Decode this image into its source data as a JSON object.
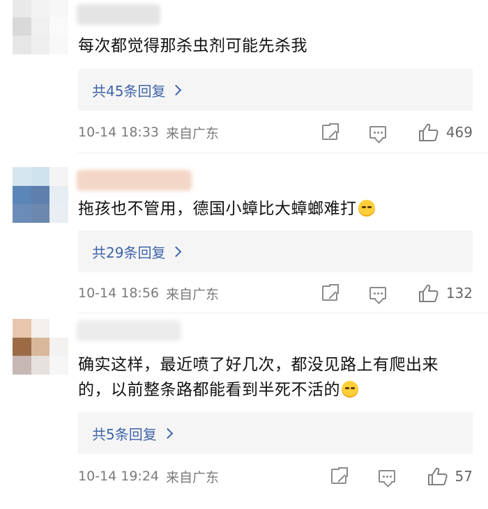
{
  "comments": [
    {
      "text": "每次都觉得那杀虫剂可能先杀我",
      "reply_label": "共45条回复",
      "time": "10-14 18:33",
      "location": "来自广东",
      "likes": "469",
      "avatar_colors": [
        "#e9e9e9",
        "#f3f3f3",
        "#f7f7f7",
        "#d9d9d9",
        "#f0f0f0",
        "#fafafa",
        "#e6e6e6",
        "#efefef",
        "#f8f8f8"
      ],
      "username_color": "#e4e4e4"
    },
    {
      "text": "拖孩也不管用，德国小蟑比大蟑螂难打",
      "emoji": "sleepy-face-emoji",
      "reply_label": "共29条回复",
      "time": "10-14 18:56",
      "location": "来自广东",
      "likes": "132",
      "avatar_colors": [
        "#d6e6ee",
        "#cfe3ef",
        "#f4f4f4",
        "#5a87b8",
        "#5f7fae",
        "#e6eef4",
        "#6b8bb8",
        "#6d88af",
        "#e9eef3"
      ],
      "username_color": "#f3d6c6"
    },
    {
      "text": "确实这样，最近喷了好几次，都没见路上有爬出来的，以前整条路都能看到半死不活的",
      "emoji": "fearful-face-emoji",
      "reply_label": "共5条回复",
      "time": "10-14 19:24",
      "location": "来自广东",
      "likes": "57",
      "avatar_colors": [
        "#e8c6ad",
        "#f3f0ee",
        "#ffffff",
        "#9c6b46",
        "#d8b79a",
        "#f4f2f0",
        "#c8b8b5",
        "#e7e1dd",
        "#f6f6f6"
      ],
      "username_color": "#ececec"
    }
  ],
  "icons": {
    "share": "share-icon",
    "comment": "comment-icon",
    "like": "thumbs-up-icon"
  },
  "colors": {
    "reply_link": "#3d64a8",
    "meta_text": "#7a7a7a",
    "reply_bg": "#f5f5f5"
  }
}
